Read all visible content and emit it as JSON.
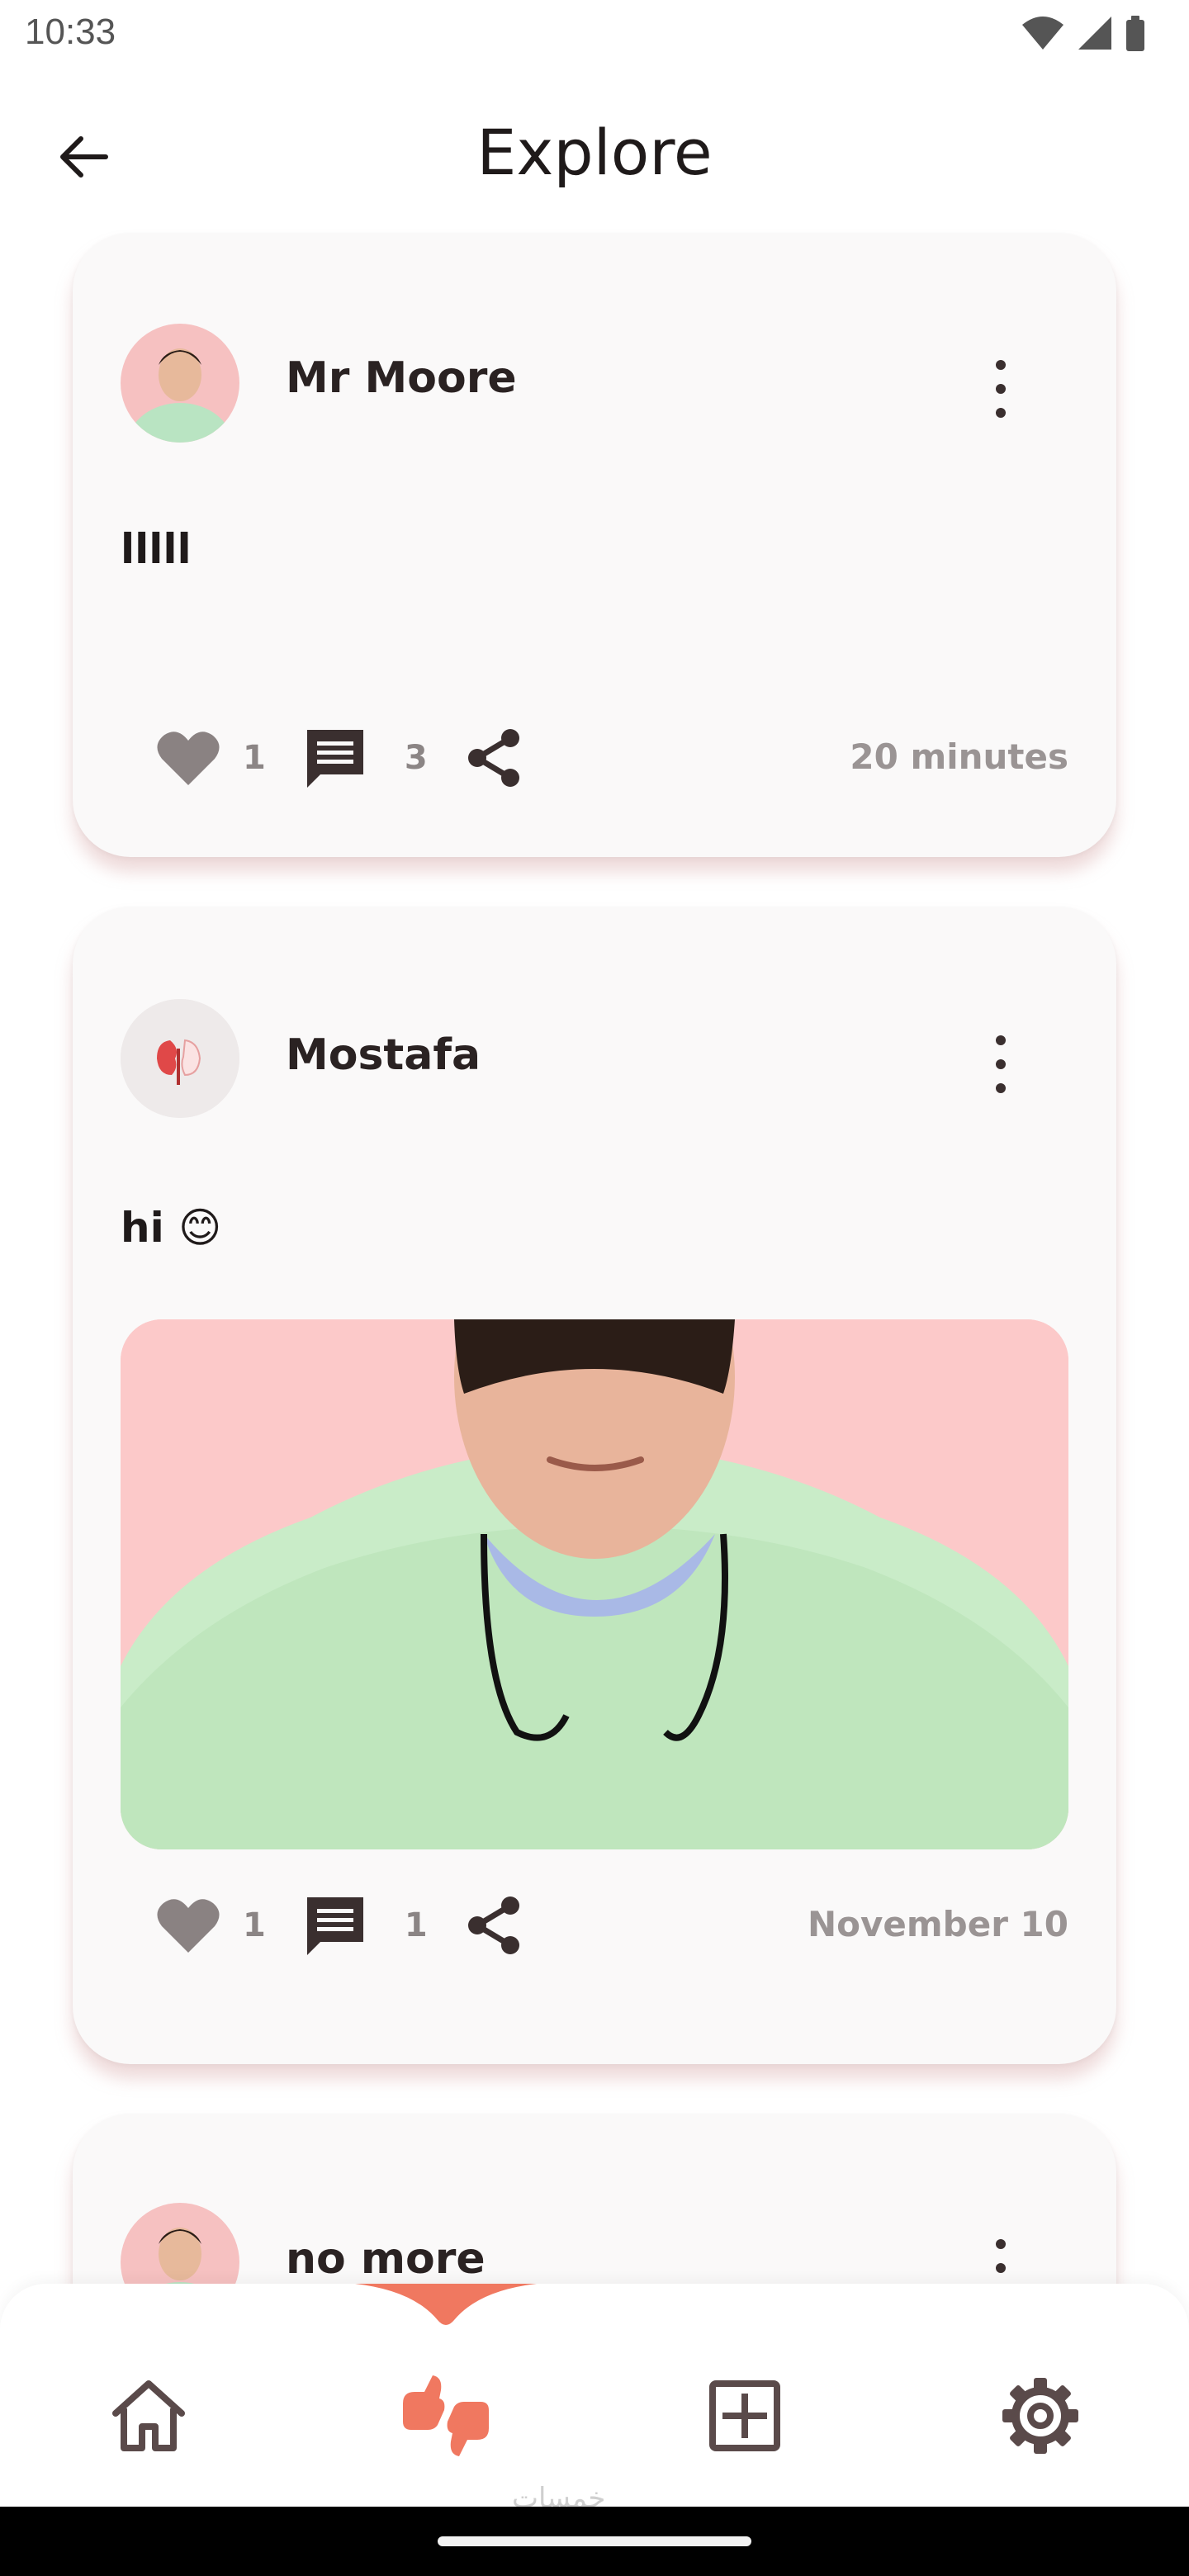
{
  "status_bar": {
    "time": "10:33"
  },
  "app_bar": {
    "title": "Explore"
  },
  "posts": [
    {
      "author": "Mr Moore",
      "text": "lllll",
      "likes": "1",
      "comments": "3",
      "time": "20 minutes",
      "has_image": false
    },
    {
      "author": "Mostafa",
      "text": "hi 😊",
      "likes": "1",
      "comments": "1",
      "time": "November 10",
      "has_image": true
    },
    {
      "author": "no more"
    }
  ],
  "bottom_nav": {
    "items": [
      "home-icon",
      "explore-icon",
      "add-post-icon",
      "settings-icon"
    ],
    "active": "explore-icon",
    "watermark": "خمسات"
  },
  "colors": {
    "accent": "#f07860",
    "icon": "#5a4a4a",
    "text_muted": "#9a9494",
    "card_bg": "#faf9f9"
  }
}
